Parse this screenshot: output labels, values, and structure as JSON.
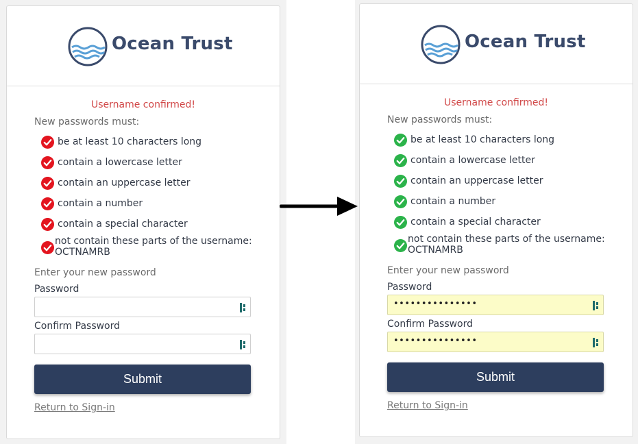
{
  "brand": {
    "name": "Ocean Trust"
  },
  "colors": {
    "accent": "#2d3e5e",
    "error": "#d14848",
    "fail_check": "#e3151f",
    "pass_check": "#2bb34a",
    "autofill_bg": "#fcfcc8"
  },
  "before": {
    "confirmed": "Username confirmed!",
    "rules_title": "New passwords must:",
    "rules": [
      {
        "text": "be at least 10 characters long",
        "status": "fail"
      },
      {
        "text": "contain a lowercase letter",
        "status": "fail"
      },
      {
        "text": "contain an uppercase letter",
        "status": "fail"
      },
      {
        "text": "contain a number",
        "status": "fail"
      },
      {
        "text": "contain a special character",
        "status": "fail"
      },
      {
        "text": "not contain these parts of the username: OCTNAMRB",
        "status": "fail"
      }
    ],
    "enter_label": "Enter your new password",
    "password_label": "Password",
    "password_value": "",
    "confirm_label": "Confirm Password",
    "confirm_value": "",
    "submit_label": "Submit",
    "return_link": "Return to Sign-in"
  },
  "after": {
    "confirmed": "Username confirmed!",
    "rules_title": "New passwords must:",
    "rules": [
      {
        "text": "be at least 10 characters long",
        "status": "pass"
      },
      {
        "text": "contain a lowercase letter",
        "status": "pass"
      },
      {
        "text": "contain an uppercase letter",
        "status": "pass"
      },
      {
        "text": "contain a number",
        "status": "pass"
      },
      {
        "text": "contain a special character",
        "status": "pass"
      },
      {
        "text": "not contain these parts of the username: OCTNAMRB",
        "status": "pass"
      }
    ],
    "enter_label": "Enter your new password",
    "password_label": "Password",
    "password_value": "•••••••••••••••",
    "confirm_label": "Confirm Password",
    "confirm_value": "•••••••••••••••",
    "submit_label": "Submit",
    "return_link": "Return to Sign-in"
  },
  "icons": {
    "logo": "ocean-waves-logo",
    "fail": "red-check-circle-icon",
    "pass": "green-check-circle-icon",
    "field": "password-manager-key-icon",
    "transition": "right-arrow-icon"
  }
}
